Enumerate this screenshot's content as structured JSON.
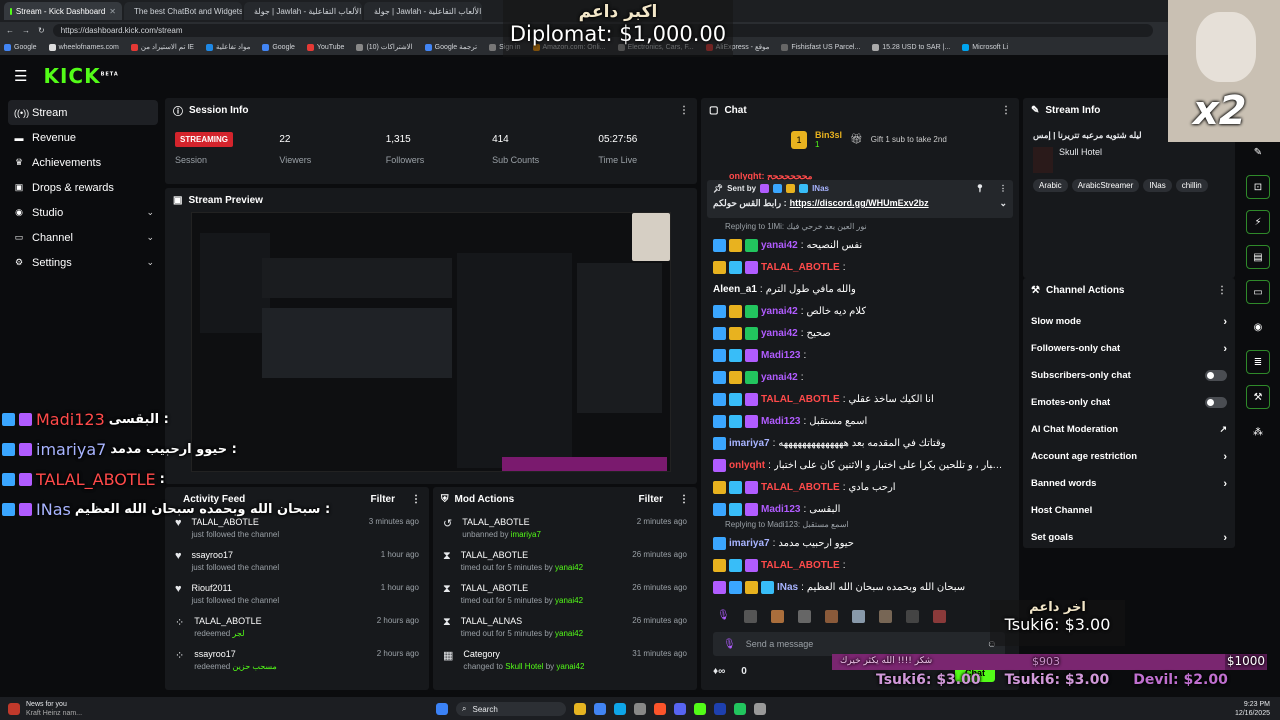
{
  "browser": {
    "tabs": [
      {
        "label": "Stream - Kick Dashboard",
        "active": true
      },
      {
        "label": "The best ChatBot and Widgets fo",
        "active": false
      },
      {
        "label": "جولة | Jawlah - منصة الألعاب التفاعلية",
        "active": false
      },
      {
        "label": "جولة | Jawlah - منصة الألعاب التفاعلية",
        "active": false
      }
    ],
    "url": "https://dashboard.kick.com/stream",
    "bookmarks": [
      "Google",
      "wheelofnames.com",
      "تم الاستيراد من IE",
      "مواد تفاعلية",
      "Google",
      "YouTube",
      "(10) الاشتراكات",
      "Google ترجمة",
      "Sign in",
      "Amazon.com: Onli...",
      "Electronics, Cars, F...",
      "AliExpress - موقع",
      "Fishisfast US Parcel...",
      "15.28 USD to SAR |...",
      "Microsoft Li"
    ]
  },
  "app": {
    "logo": "KICK",
    "logo_sup": "BETA"
  },
  "sidebar": {
    "items": [
      {
        "label": "Stream",
        "icon": "stream-icon",
        "active": true,
        "expandable": false
      },
      {
        "label": "Revenue",
        "icon": "revenue-icon",
        "active": false,
        "expandable": false
      },
      {
        "label": "Achievements",
        "icon": "trophy-icon",
        "active": false,
        "expandable": false
      },
      {
        "label": "Drops & rewards",
        "icon": "gift-icon",
        "active": false,
        "expandable": false
      },
      {
        "label": "Studio",
        "icon": "studio-icon",
        "active": false,
        "expandable": true
      },
      {
        "label": "Channel",
        "icon": "channel-icon",
        "active": false,
        "expandable": true
      },
      {
        "label": "Settings",
        "icon": "settings-icon",
        "active": false,
        "expandable": true
      }
    ]
  },
  "session": {
    "title": "Session Info",
    "status": "STREAMING",
    "status_label": "Session",
    "stats": [
      {
        "value": "22",
        "label": "Viewers"
      },
      {
        "value": "1,315",
        "label": "Followers"
      },
      {
        "value": "414",
        "label": "Sub Counts"
      },
      {
        "value": "05:27:56",
        "label": "Time Live"
      }
    ]
  },
  "preview": {
    "title": "Stream Preview"
  },
  "activity": {
    "title": "Activity Feed",
    "filter": "Filter",
    "rows": [
      {
        "icon": "heart-icon",
        "name": "TALAL_ABOTLE",
        "action": "just followed the channel",
        "extra": "",
        "time": "3 minutes ago"
      },
      {
        "icon": "heart-icon",
        "name": "ssayroo17",
        "action": "just followed the channel",
        "extra": "",
        "time": "1 hour ago"
      },
      {
        "icon": "heart-icon",
        "name": "Riouf2011",
        "action": "just followed the channel",
        "extra": "",
        "time": "1 hour ago"
      },
      {
        "icon": "reward-icon",
        "name": "TALAL_ABOTLE",
        "action": "redeemed",
        "extra": "لجر",
        "time": "2 hours ago"
      },
      {
        "icon": "reward-icon",
        "name": "ssayroo17",
        "action": "redeemed",
        "extra": "مسحب حزين",
        "time": "2 hours ago"
      }
    ]
  },
  "mod": {
    "title": "Mod Actions",
    "filter": "Filter",
    "rows": [
      {
        "icon": "undo-icon",
        "name": "TALAL_ABOTLE",
        "action": "unbanned by",
        "by": "imariya7",
        "time": "2 minutes ago"
      },
      {
        "icon": "hourglass-icon",
        "name": "TALAL_ABOTLE",
        "action": "timed out for 5 minutes by",
        "by": "yanai42",
        "time": "26 minutes ago"
      },
      {
        "icon": "hourglass-icon",
        "name": "TALAL_ABOTLE",
        "action": "timed out for 5 minutes by",
        "by": "yanai42",
        "time": "26 minutes ago"
      },
      {
        "icon": "hourglass-icon",
        "name": "TALAL_ALNAS",
        "action": "timed out for 5 minutes by",
        "by": "yanai42",
        "time": "26 minutes ago"
      },
      {
        "icon": "category-icon",
        "name": "Category",
        "action": "changed to",
        "by": "Skull Hotel",
        "by2": "yanai42",
        "time": "31 minutes ago"
      }
    ]
  },
  "chat": {
    "title": "Chat",
    "gift": {
      "name": "Bin3sl",
      "count": "1",
      "text": "Gift 1 sub to take 2nd"
    },
    "partial": "onlyqht: مححححححح",
    "pinned": {
      "sent_by": "Sent by",
      "user": "INas",
      "prefix": "رابط القس حولكم :",
      "link": "https://discord.gg/WHUmExv2bz"
    },
    "messages": [
      {
        "reply": "Replying to 1lMi: نور العين بعد خرحي فيك",
        "user": "yanai42",
        "color": "#b15cff",
        "badges": [
          "blue",
          "gold",
          "green"
        ],
        "text": "نفس النصيحه"
      },
      {
        "reply": "",
        "user": "TALAL_ABOTLE",
        "color": "#ff4a4a",
        "badges": [
          "gold",
          "teal",
          "purple"
        ],
        "text": ""
      },
      {
        "reply": "",
        "user": "Aleen_a1",
        "color": "#ffffff",
        "badges": [],
        "text": "والله مافي طول الترم"
      },
      {
        "reply": "",
        "user": "yanai42",
        "color": "#b15cff",
        "badges": [
          "blue",
          "gold",
          "green"
        ],
        "text": "كلام ديه خالص"
      },
      {
        "reply": "",
        "user": "yanai42",
        "color": "#b15cff",
        "badges": [
          "blue",
          "gold",
          "green"
        ],
        "text": "صحيح"
      },
      {
        "reply": "",
        "user": "Madi123",
        "color": "#b15cff",
        "badges": [
          "blue",
          "teal",
          "purple"
        ],
        "text": ""
      },
      {
        "reply": "",
        "user": "yanai42",
        "color": "#b15cff",
        "badges": [
          "blue",
          "gold",
          "green"
        ],
        "text": ""
      },
      {
        "reply": "",
        "user": "TALAL_ABOTLE",
        "color": "#ff4a4a",
        "badges": [
          "blue",
          "teal",
          "purple"
        ],
        "text": "انا الكيك ساخذ عقلي"
      },
      {
        "reply": "",
        "user": "Madi123",
        "color": "#b15cff",
        "badges": [
          "blue",
          "teal",
          "purple"
        ],
        "text": "اسمع مستقبل"
      },
      {
        "reply": "",
        "user": "imariya7",
        "color": "#a8b4ff",
        "badges": [
          "blue"
        ],
        "text": "وقتاتك في المقدمه بعد ههههههههههههههه"
      },
      {
        "reply": "",
        "user": "onlyqht",
        "color": "#ff4a4a",
        "badges": [
          "purple"
        ],
        "text": "ي نصوص وربي ما اكتب كل أسبوع اختبار ، و تللحين بكرا على اختبار و الاثنين كان على اختبار"
      },
      {
        "reply": "",
        "user": "TALAL_ABOTLE",
        "color": "#ff4a4a",
        "badges": [
          "gold",
          "teal",
          "purple"
        ],
        "text": "ارحب مادي"
      },
      {
        "reply": "",
        "user": "Madi123",
        "color": "#b15cff",
        "badges": [
          "blue",
          "teal",
          "purple"
        ],
        "text": "البقسى"
      },
      {
        "reply": "Replying to Madi123: اسمع مستقبل",
        "user": "imariya7",
        "color": "#a8b4ff",
        "badges": [
          "blue"
        ],
        "text": "حيوو ارحبيب مدمد"
      },
      {
        "reply": "",
        "user": "TALAL_ABOTLE",
        "color": "#ff4a4a",
        "badges": [
          "gold",
          "teal",
          "purple"
        ],
        "text": ""
      },
      {
        "reply": "",
        "user": "INas",
        "color": "#a8b4ff",
        "badges": [
          "purple",
          "blue",
          "gold",
          "teal"
        ],
        "text": "سبحان الله وبحمده سبحان الله العظيم"
      }
    ],
    "input_placeholder": "Send a message",
    "viewer_count": "0",
    "chat_button": "Chat"
  },
  "stream_info": {
    "title": "Stream Info",
    "stream_title": "ليله شتويه مرعبه تتريرنا | إمس",
    "category": "Skull Hotel",
    "tags": [
      "Arabic",
      "ArabicStreamer",
      "INas",
      "chillin"
    ]
  },
  "channel_actions": {
    "title": "Channel Actions",
    "items": [
      {
        "label": "Slow mode",
        "type": "arrow"
      },
      {
        "label": "Followers-only chat",
        "type": "arrow"
      },
      {
        "label": "Subscribers-only chat",
        "type": "toggle"
      },
      {
        "label": "Emotes-only chat",
        "type": "toggle"
      },
      {
        "label": "AI Chat Moderation",
        "type": "external"
      },
      {
        "label": "Account age restriction",
        "type": "arrow"
      },
      {
        "label": "Banned words",
        "type": "arrow"
      },
      {
        "label": "Host Channel",
        "type": "none"
      },
      {
        "label": "Set goals",
        "type": "arrow"
      }
    ]
  },
  "overlays": {
    "top_title": "اكبر داعم",
    "top_amount": "Diplomat: $1,000.00",
    "x2": "x2",
    "chat_overlay": [
      {
        "user": "Madi123",
        "text": "البقسى :"
      },
      {
        "user": "imariya7",
        "text": "حيوو ارحبيب مدمد :"
      },
      {
        "user": "TALAL_ABOTLE",
        "text": ":"
      },
      {
        "user": "INas",
        "text": "سبحان الله وبحمده سبحان الله العظيم :"
      }
    ],
    "last_title": "اخر داعم",
    "last_amount": "Tsuki6: $3.00",
    "goal_label": "شكر !!!! الله يكثر خيرك",
    "goal_progress": "$903",
    "goal_target": "$1000",
    "ticker": [
      "Tsuki6: $3.00",
      "Tsuki6: $3.00",
      "Devil: $2.00"
    ]
  },
  "taskbar": {
    "news_title": "News for you",
    "news_sub": "Kraft Heinz nam...",
    "search": "Search",
    "time": "9:23 PM",
    "date": "12/16/2025"
  }
}
